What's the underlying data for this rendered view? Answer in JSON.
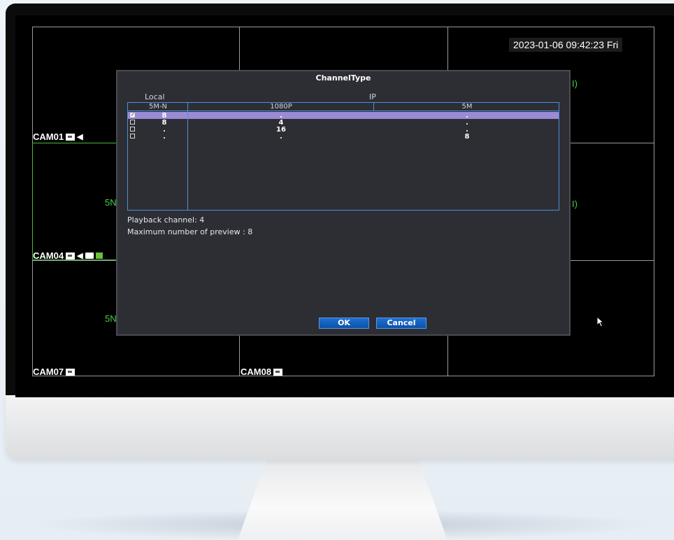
{
  "screen": {
    "datetime": "2023-01-06 09:42:23 Fri",
    "cameras": [
      {
        "label": "CAM01"
      },
      {
        "label": "CAM04"
      },
      {
        "label": "CAM07"
      },
      {
        "label": "CAM08"
      }
    ],
    "partial_texts": [
      "5N",
      "5N",
      "I)",
      "I)"
    ]
  },
  "dialog": {
    "title": "ChannelType",
    "group_local": "Local",
    "group_ip": "IP",
    "columns": [
      "5M-N",
      "1080P",
      "5M"
    ],
    "rows": [
      {
        "checked": true,
        "local_5mn": "8",
        "ip_1080p": ".",
        "ip_5m": "."
      },
      {
        "checked": false,
        "local_5mn": "8",
        "ip_1080p": "4",
        "ip_5m": "."
      },
      {
        "checked": false,
        "local_5mn": ".",
        "ip_1080p": "16",
        "ip_5m": "."
      },
      {
        "checked": false,
        "local_5mn": ".",
        "ip_1080p": ".",
        "ip_5m": "8"
      }
    ],
    "playback_channel": "Playback channel: 4",
    "max_preview": "Maximum number of preview   : 8",
    "ok_label": "OK",
    "cancel_label": "Cancel"
  },
  "colors": {
    "selected_row": "#9b8ad4",
    "table_border": "#4a90e2",
    "button_blue": "#1e6fd1",
    "dialog_bg": "#2d2e33",
    "osd_green": "#4ad04a"
  }
}
